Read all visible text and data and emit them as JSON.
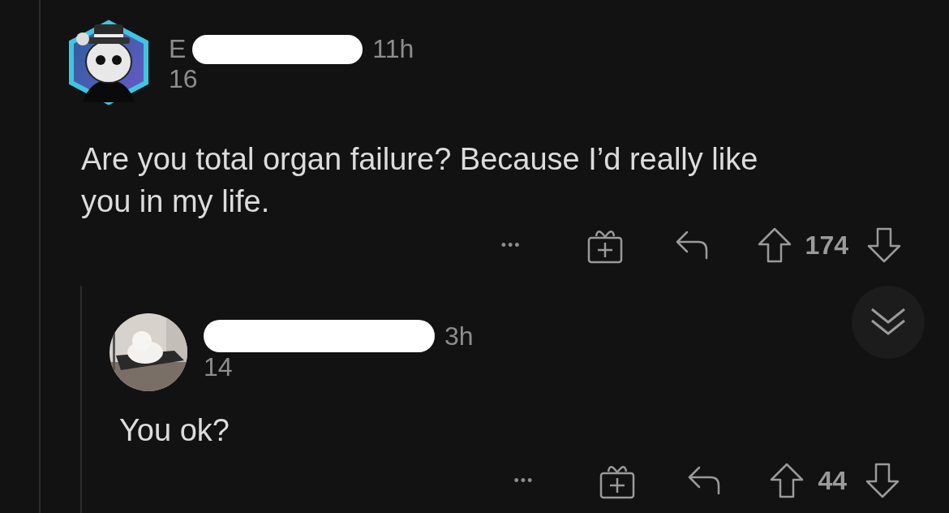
{
  "comments": [
    {
      "avatar": {
        "kind": "hexagon"
      },
      "author": "E",
      "redacted": true,
      "age": "11h",
      "karma": "16",
      "body": "Are you total organ failure? Because I’d really like you in my life.",
      "more": "•••",
      "votes": "174",
      "replies": [
        {
          "redacted": true,
          "age": "3h",
          "karma": "14",
          "body": "You ok?",
          "more": "•••",
          "votes": "44",
          "collapsible": true
        }
      ]
    }
  ]
}
